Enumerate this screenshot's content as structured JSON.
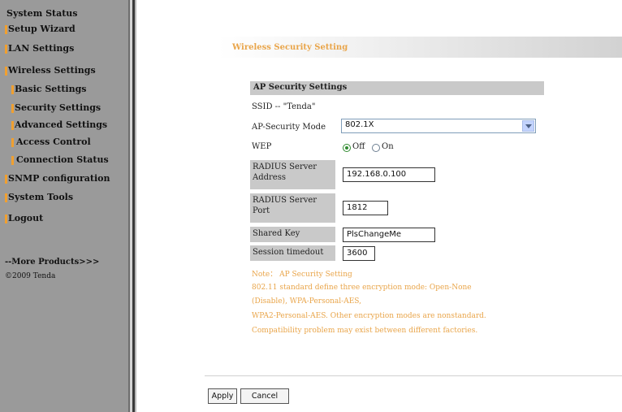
{
  "sidebar": {
    "items": [
      {
        "label": "System Status",
        "marked": false
      },
      {
        "label": "Setup Wizard",
        "marked": true
      },
      {
        "label": "LAN Settings",
        "marked": true
      },
      {
        "label": "Wireless Settings",
        "marked": true
      },
      {
        "label": "Basic Settings",
        "marked": true
      },
      {
        "label": "Security Settings",
        "marked": true
      },
      {
        "label": "Advanced Settings",
        "marked": true
      },
      {
        "label": "Access Control",
        "marked": true
      },
      {
        "label": "Connection Status",
        "marked": true
      },
      {
        "label": "SNMP configuration",
        "marked": true
      },
      {
        "label": "System Tools",
        "marked": true
      },
      {
        "label": "Logout",
        "marked": true
      }
    ],
    "more_products": "--More Products>>>",
    "copyright": "©2009 Tenda",
    "accent_color": "#f0a030"
  },
  "main": {
    "section_title": "Wireless Security Setting",
    "ap_header": "AP Security Settings",
    "ssid_text": "SSID -- \"Tenda\"",
    "mode_label": "AP-Security Mode",
    "mode_value": "802.1X",
    "wep_label": "WEP",
    "wep_off": "Off",
    "wep_on": "On",
    "wep_selected": "Off",
    "radius_addr_label_1": "RADIUS Server",
    "radius_addr_label_2": "Address",
    "radius_addr_value": "192.168.0.100",
    "radius_port_label_1": "RADIUS Server",
    "radius_port_label_2": "Port",
    "radius_port_value": "1812",
    "shared_key_label": "Shared Key",
    "shared_key_value": "PlsChangeMe",
    "session_label": "Session timedout",
    "session_value": "3600",
    "note_title": "Note： AP Security Setting",
    "note_lines": [
      "802.11 standard define three encryption mode: Open-None",
      "(Disable), WPA-Personal-AES,",
      "WPA2-Personal-AES. Other encryption modes are nonstandard.",
      "Compatibility problem may exist between different factories."
    ],
    "note_color": "#e9a54a"
  },
  "buttons": {
    "apply": "Apply",
    "cancel": "Cancel"
  }
}
